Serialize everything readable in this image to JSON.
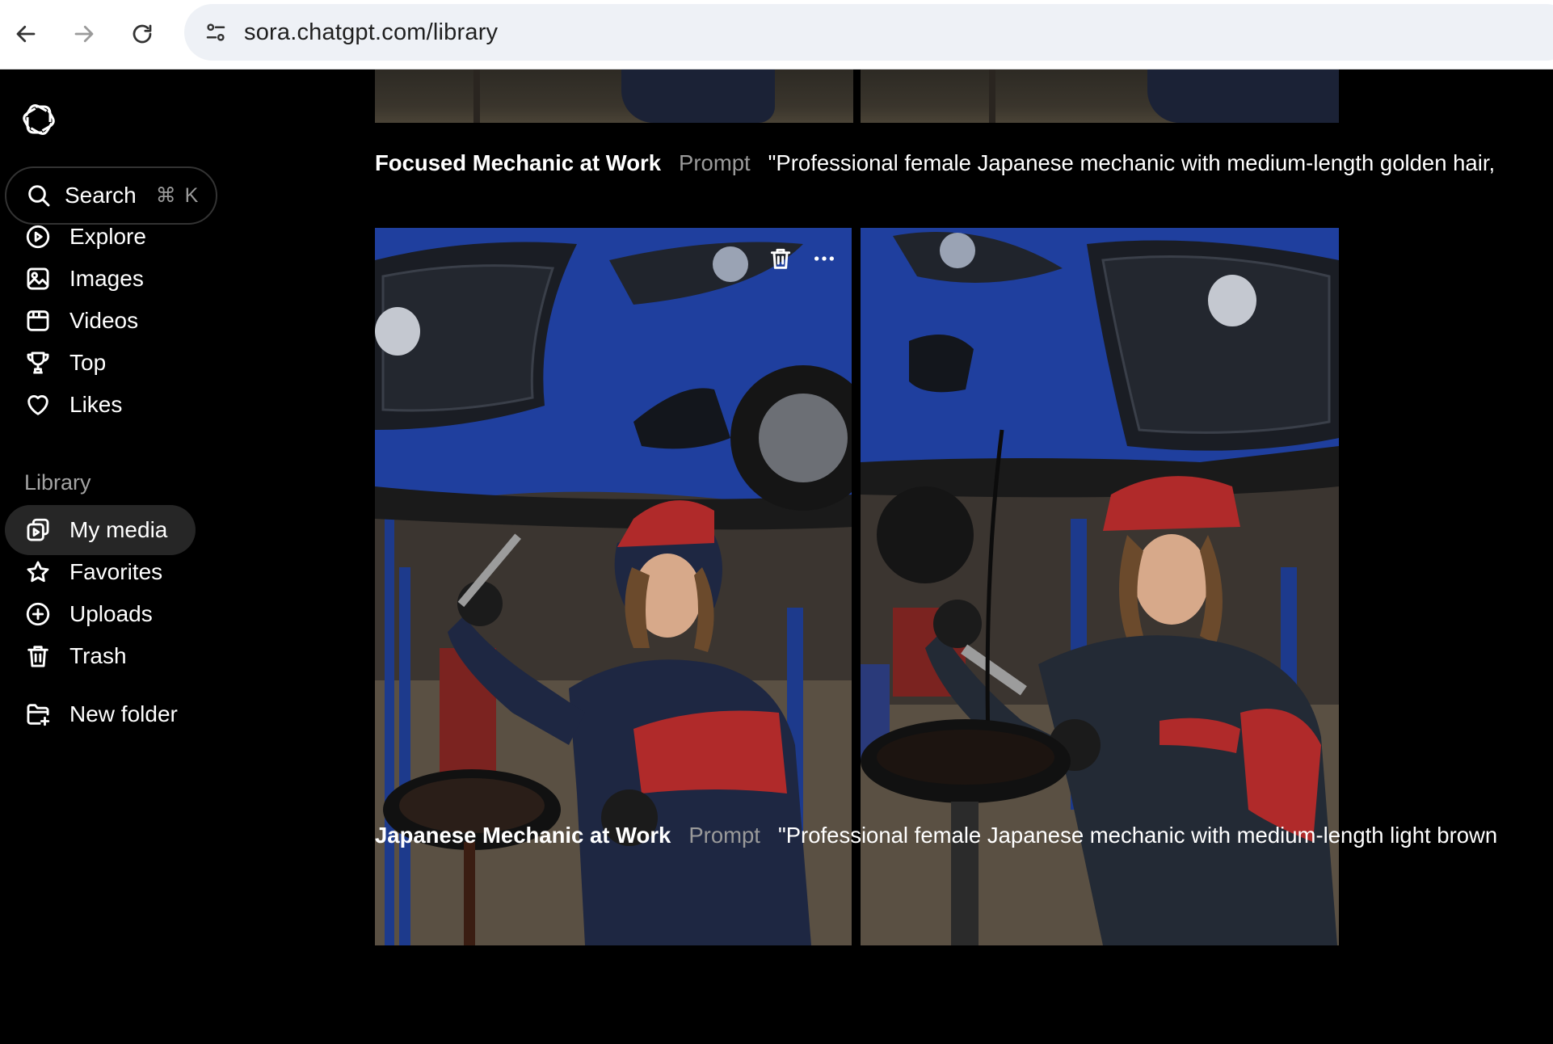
{
  "browser": {
    "url": "sora.chatgpt.com/library"
  },
  "sidebar": {
    "search": {
      "label": "Search",
      "shortcut": "⌘ K"
    },
    "nav": [
      {
        "label": "Explore",
        "icon": "explore-icon"
      },
      {
        "label": "Images",
        "icon": "images-icon"
      },
      {
        "label": "Videos",
        "icon": "videos-icon"
      },
      {
        "label": "Top",
        "icon": "trophy-icon"
      },
      {
        "label": "Likes",
        "icon": "heart-icon"
      }
    ],
    "library_title": "Library",
    "library": [
      {
        "label": "My media",
        "icon": "my-media-icon",
        "active": true
      },
      {
        "label": "Favorites",
        "icon": "star-icon"
      },
      {
        "label": "Uploads",
        "icon": "plus-circle-icon"
      },
      {
        "label": "Trash",
        "icon": "trash-icon"
      }
    ],
    "new_folder": {
      "label": "New folder",
      "icon": "folder-plus-icon"
    }
  },
  "feed": [
    {
      "title": "Focused Mechanic at Work",
      "prompt_label": "Prompt",
      "prompt": "\"Professional female Japanese mechanic with medium-length golden hair,"
    },
    {
      "title": "Japanese Mechanic at Work",
      "prompt_label": "Prompt",
      "prompt": "\"Professional female Japanese mechanic with medium-length light brown"
    }
  ],
  "colors": {
    "background": "#000000",
    "car_blue": "#1f3f9e",
    "cap_red": "#b02a2a",
    "uniform_navy": "#1e2742",
    "muted_text": "#9a9a9a"
  }
}
